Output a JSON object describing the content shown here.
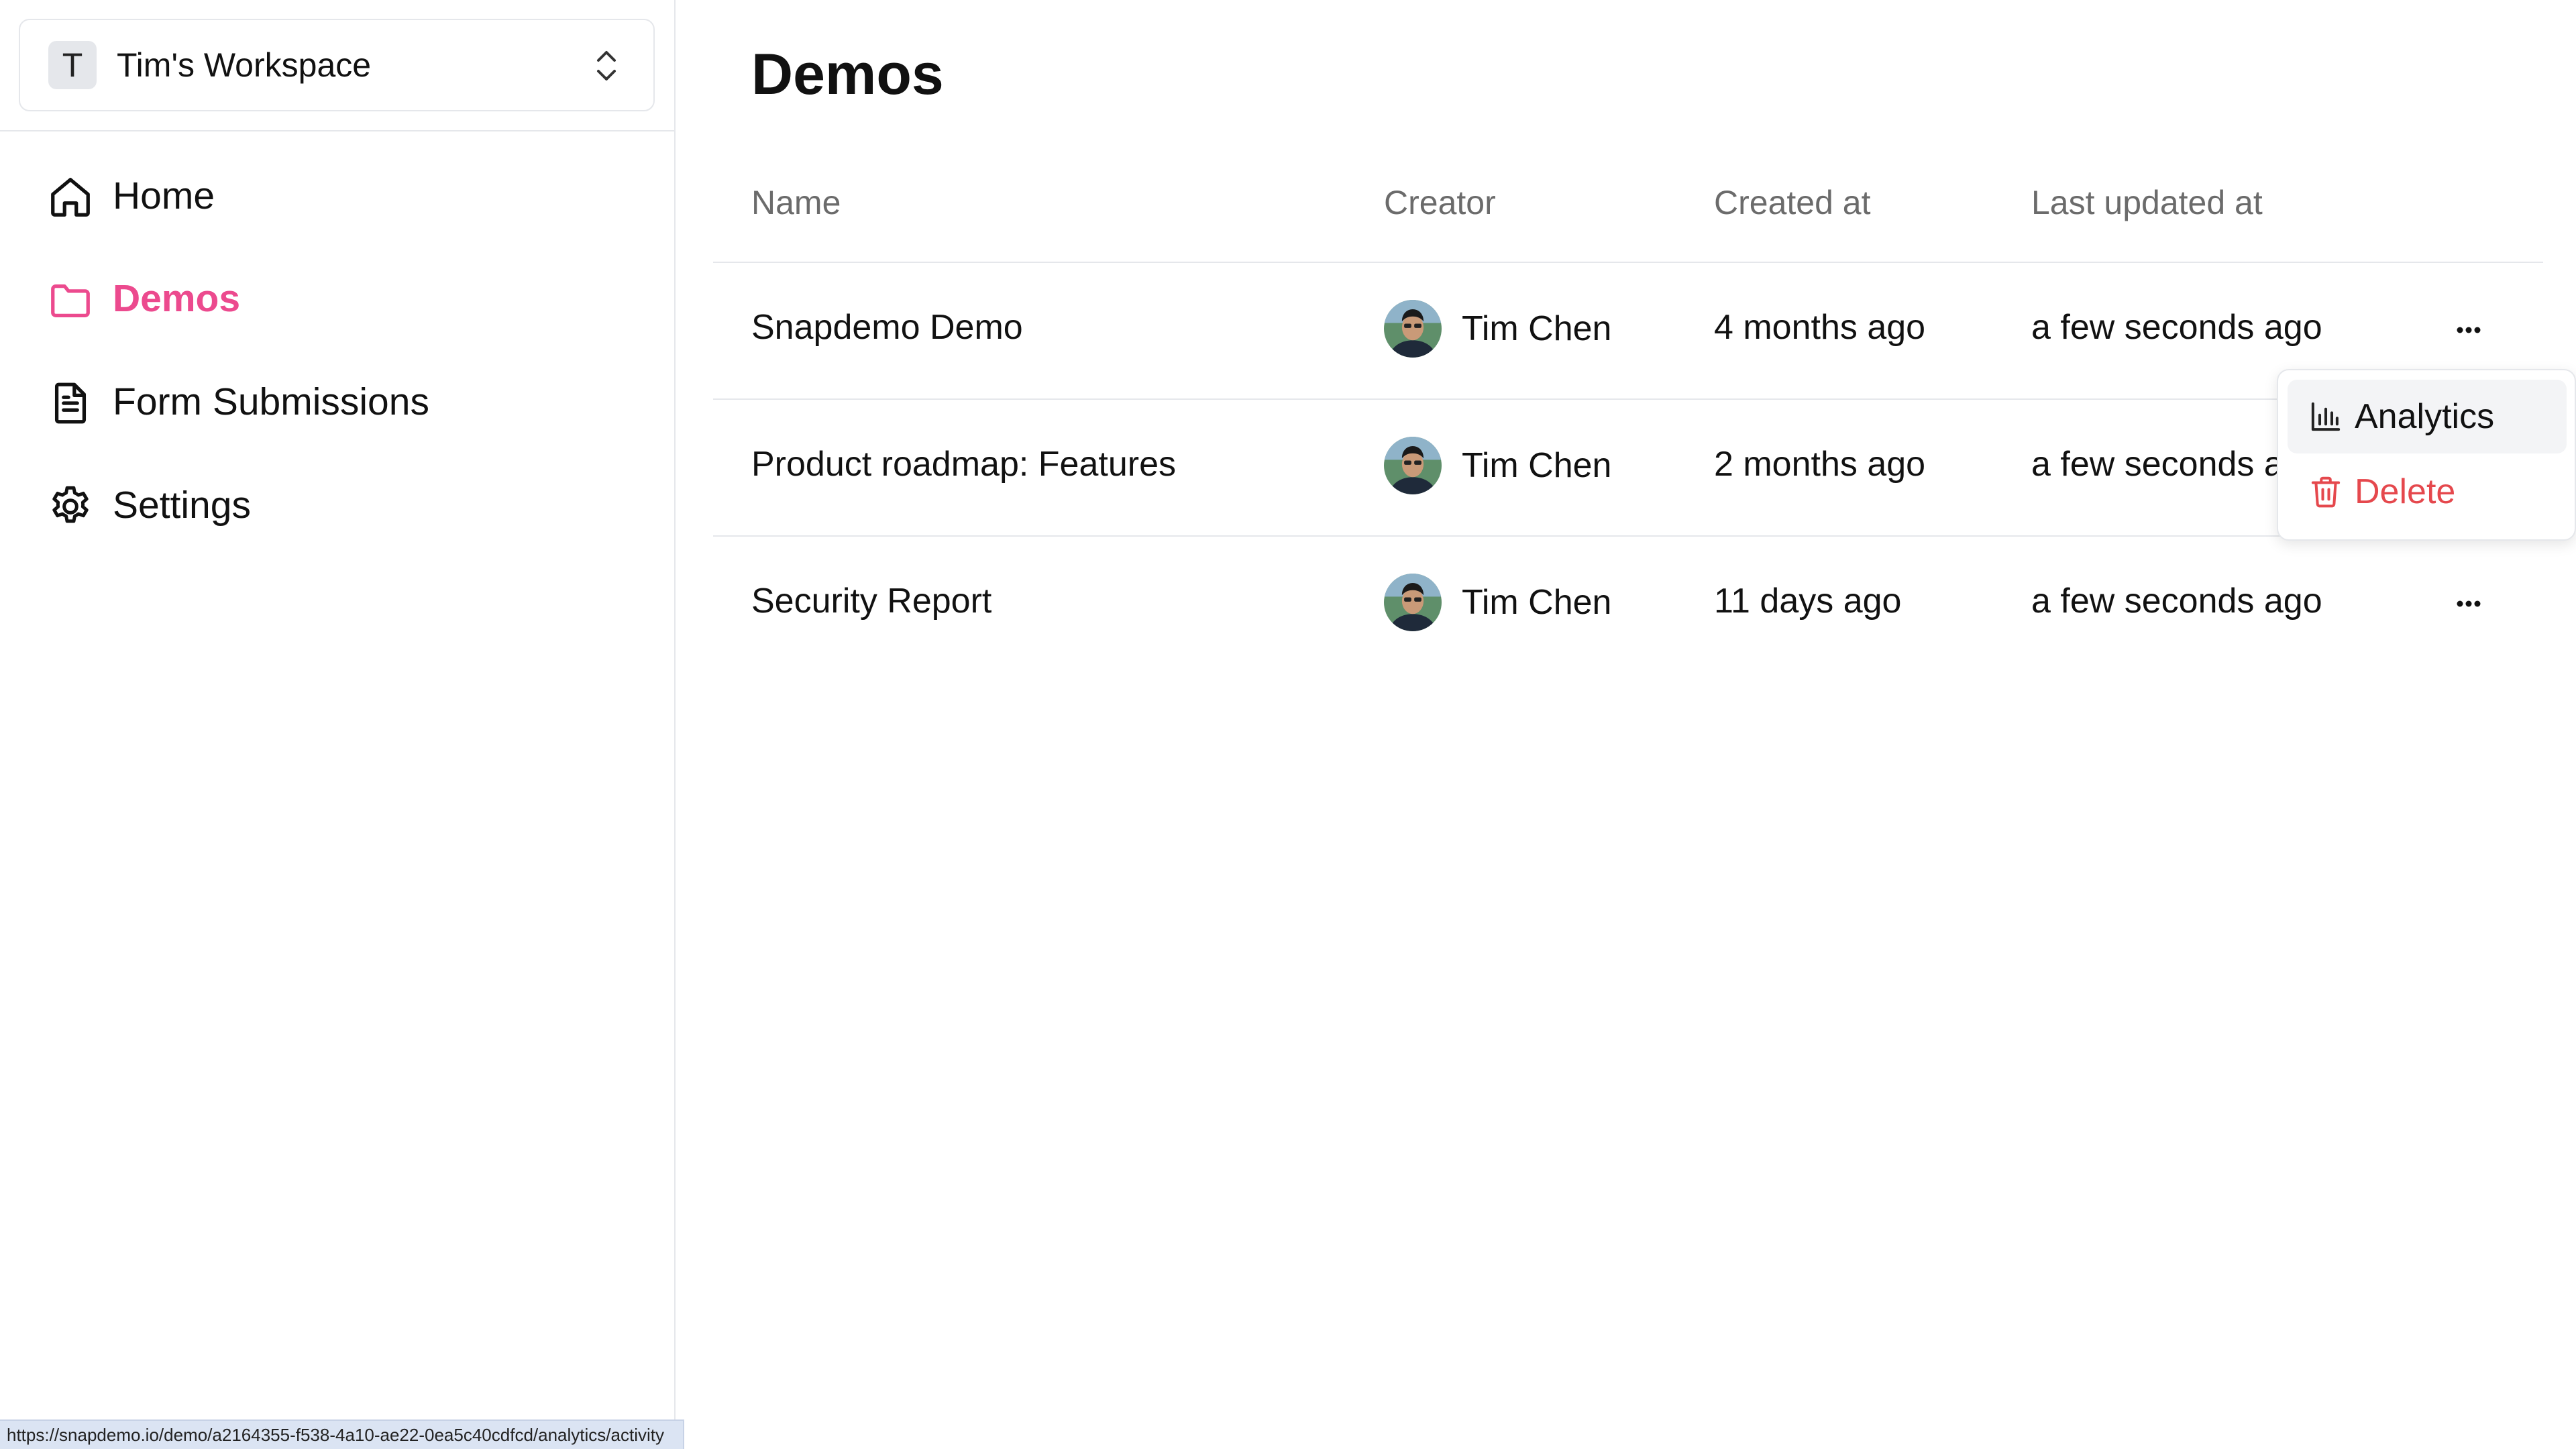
{
  "workspace": {
    "initial": "T",
    "name": "Tim's Workspace"
  },
  "sidebar": {
    "items": [
      {
        "label": "Home",
        "icon": "home-icon"
      },
      {
        "label": "Demos",
        "icon": "folder-icon",
        "active": true
      },
      {
        "label": "Form Submissions",
        "icon": "document-icon"
      },
      {
        "label": "Settings",
        "icon": "gear-icon"
      }
    ]
  },
  "page": {
    "title": "Demos"
  },
  "table": {
    "columns": [
      "Name",
      "Creator",
      "Created at",
      "Last updated at"
    ],
    "rows": [
      {
        "name": "Snapdemo Demo",
        "creator": "Tim Chen",
        "created_at": "4 months ago",
        "updated_at": "a few seconds ago"
      },
      {
        "name": "Product roadmap: Features",
        "creator": "Tim Chen",
        "created_at": "2 months ago",
        "updated_at": "a few seconds ago"
      },
      {
        "name": "Security Report",
        "creator": "Tim Chen",
        "created_at": "11 days ago",
        "updated_at": "a few seconds ago"
      }
    ]
  },
  "row_menu": {
    "items": [
      {
        "label": "Analytics",
        "icon": "bar-chart-icon"
      },
      {
        "label": "Delete",
        "icon": "trash-icon"
      }
    ]
  },
  "status_bar": {
    "url": "https://snapdemo.io/demo/a2164355-f538-4a10-ae22-0ea5c40cdfcd/analytics/activity"
  },
  "colors": {
    "accent": "#ec4a8e",
    "danger": "#e5484d",
    "border": "#e5e7eb",
    "muted_text": "#6b6b6b"
  }
}
